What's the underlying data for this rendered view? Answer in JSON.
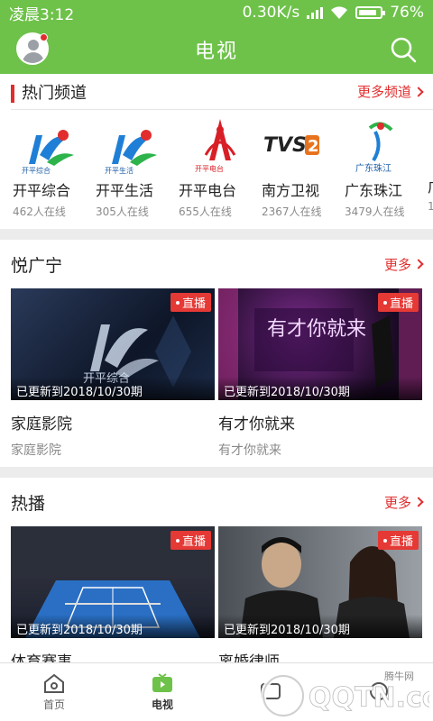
{
  "status_bar": {
    "time": "凌晨3:12",
    "speed": "0.30K/s",
    "battery": "76%"
  },
  "app_bar": {
    "title": "电视"
  },
  "hot_channels": {
    "title": "热门频道",
    "more": "更多频道",
    "items": [
      {
        "name": "开平综合",
        "count": "462人在线",
        "logo_text": "开平综合"
      },
      {
        "name": "开平生活",
        "count": "305人在线",
        "logo_text": "开平生活"
      },
      {
        "name": "开平电台",
        "count": "655人在线",
        "logo_text": "开平电台"
      },
      {
        "name": "南方卫视",
        "count": "2367人在线",
        "logo_text": "TVS2"
      },
      {
        "name": "广东珠江",
        "count": "3479人在线",
        "logo_text": "广东珠江"
      },
      {
        "name": "广",
        "count": "1",
        "logo_text": ""
      }
    ]
  },
  "yue_guangning": {
    "title": "悦广宁",
    "more": "更多",
    "cards": [
      {
        "badge": "直播",
        "update": "已更新到2018/10/30期",
        "title": "家庭影院",
        "subtitle": "家庭影院",
        "thumb_text": "开平综合"
      },
      {
        "badge": "直播",
        "update": "已更新到2018/10/30期",
        "title": "有才你就来",
        "subtitle": "有才你就来",
        "thumb_text": "有才你就来"
      }
    ]
  },
  "hot_play": {
    "title": "热播",
    "more": "更多",
    "cards": [
      {
        "badge": "直播",
        "update": "已更新到2018/10/30期",
        "title": "体育赛事"
      },
      {
        "badge": "直播",
        "update": "已更新到2018/10/30期",
        "title": "离婚律师"
      }
    ]
  },
  "tab_bar": {
    "tabs": [
      {
        "label": "首页"
      },
      {
        "label": "电视"
      },
      {
        "label": ""
      },
      {
        "label": ""
      }
    ]
  },
  "watermark": {
    "site": "QQTN.com",
    "tag": "腾牛网"
  },
  "colors": {
    "brand_green": "#6ec24a",
    "accent_red": "#e12d2d"
  }
}
